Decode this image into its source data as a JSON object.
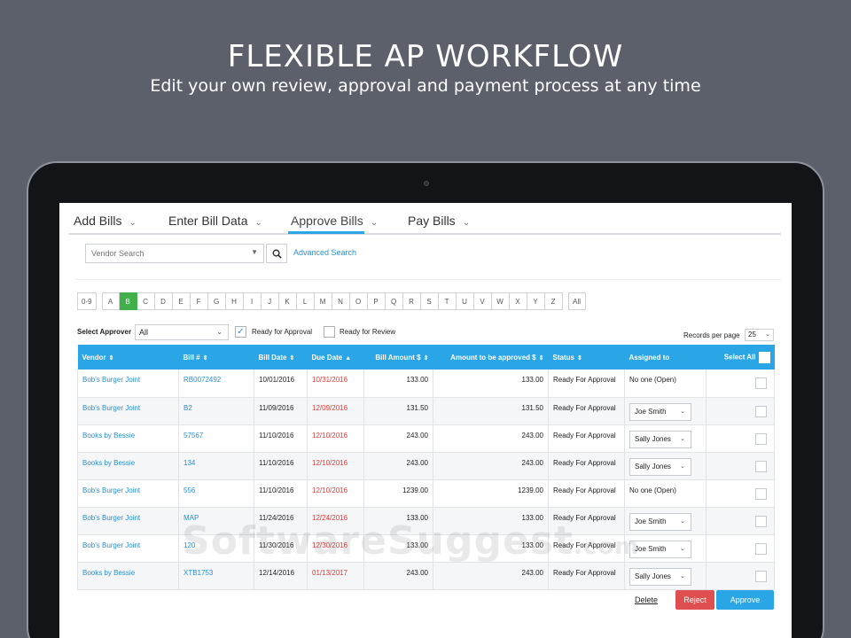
{
  "hero": {
    "title": "FLEXIBLE AP WORKFLOW",
    "subtitle": "Edit your own review, approval and payment process at any time"
  },
  "tabs": [
    {
      "label": "Add Bills",
      "active": false
    },
    {
      "label": "Enter Bill Data",
      "active": false
    },
    {
      "label": "Approve Bills",
      "active": true
    },
    {
      "label": "Pay Bills",
      "active": false
    }
  ],
  "search": {
    "placeholder": "Vendor Search",
    "advanced_label": "Advanced Search"
  },
  "letters": [
    "0-9",
    "A",
    "B",
    "C",
    "D",
    "E",
    "F",
    "G",
    "H",
    "I",
    "J",
    "K",
    "L",
    "M",
    "N",
    "O",
    "P",
    "Q",
    "R",
    "S",
    "T",
    "U",
    "V",
    "W",
    "X",
    "Y",
    "Z",
    "All"
  ],
  "active_letter": "B",
  "filters": {
    "approver_label": "Select Approver",
    "approver_value": "All",
    "ready_for_approval_label": "Ready for Approval",
    "ready_for_approval_checked": true,
    "ready_for_review_label": "Ready for Review",
    "ready_for_review_checked": false,
    "records_per_page_label": "Records per page",
    "records_per_page_value": "25"
  },
  "table": {
    "headers": {
      "vendor": "Vendor",
      "bill_no": "Bill #",
      "bill_date": "Bill Date",
      "due_date": "Due Date",
      "bill_amount": "Bill Amount $",
      "to_approve": "Amount to be approved $",
      "status": "Status",
      "assigned_to": "Assigned to",
      "select_all": "Select All"
    },
    "rows": [
      {
        "vendor": "Bob's Burger Joint",
        "bill_no": "RB0072492",
        "bill_date": "10/01/2016",
        "due_date": "10/31/2016",
        "amount": "133.00",
        "to_approve": "133.00",
        "status": "Ready For Approval",
        "assigned": "No one (Open)",
        "assigned_select": false
      },
      {
        "vendor": "Bob's Burger Joint",
        "bill_no": "B2",
        "bill_date": "11/09/2016",
        "due_date": "12/09/2016",
        "amount": "131.50",
        "to_approve": "131.50",
        "status": "Ready For Approval",
        "assigned": "Joe Smith",
        "assigned_select": true
      },
      {
        "vendor": "Books by Bessie",
        "bill_no": "57567",
        "bill_date": "11/10/2016",
        "due_date": "12/10/2016",
        "amount": "243.00",
        "to_approve": "243.00",
        "status": "Ready For Approval",
        "assigned": "Sally Jones",
        "assigned_select": true
      },
      {
        "vendor": "Books by Bessie",
        "bill_no": "134",
        "bill_date": "11/10/2016",
        "due_date": "12/10/2016",
        "amount": "243.00",
        "to_approve": "243.00",
        "status": "Ready For Approval",
        "assigned": "Sally Jones",
        "assigned_select": true
      },
      {
        "vendor": "Bob's Burger Joint",
        "bill_no": "556",
        "bill_date": "11/10/2016",
        "due_date": "12/10/2016",
        "amount": "1239.00",
        "to_approve": "1239.00",
        "status": "Ready For Approval",
        "assigned": "No one (Open)",
        "assigned_select": false
      },
      {
        "vendor": "Bob's Burger Joint",
        "bill_no": "MAP",
        "bill_date": "11/24/2016",
        "due_date": "12/24/2016",
        "amount": "133.00",
        "to_approve": "133.00",
        "status": "Ready For Approval",
        "assigned": "Joe Smith",
        "assigned_select": true
      },
      {
        "vendor": "Bob's Burger Joint",
        "bill_no": "120",
        "bill_date": "11/30/2016",
        "due_date": "12/30/2016",
        "amount": "133.00",
        "to_approve": "133.00",
        "status": "Ready For Approval",
        "assigned": "Joe Smith",
        "assigned_select": true
      },
      {
        "vendor": "Books by Bessie",
        "bill_no": "XTB1753",
        "bill_date": "12/14/2016",
        "due_date": "01/13/2017",
        "amount": "243.00",
        "to_approve": "243.00",
        "status": "Ready For Approval",
        "assigned": "Sally Jones",
        "assigned_select": true
      }
    ]
  },
  "actions": {
    "delete_label": "Delete",
    "reject_label": "Reject",
    "approve_label": "Approve"
  },
  "watermark": {
    "text": "SoftwareSuggest",
    "suffix": ".com"
  },
  "colors": {
    "background": "#5b606a",
    "accent": "#2aa5e6",
    "active_letter": "#3fb04a",
    "reject": "#e04f4f",
    "due_date": "#e53935",
    "link": "#2a8fd0"
  },
  "icons": {
    "search": "search-icon",
    "dropdown": "chevron-down-icon",
    "sort": "sort-icon",
    "check": "check-icon"
  }
}
